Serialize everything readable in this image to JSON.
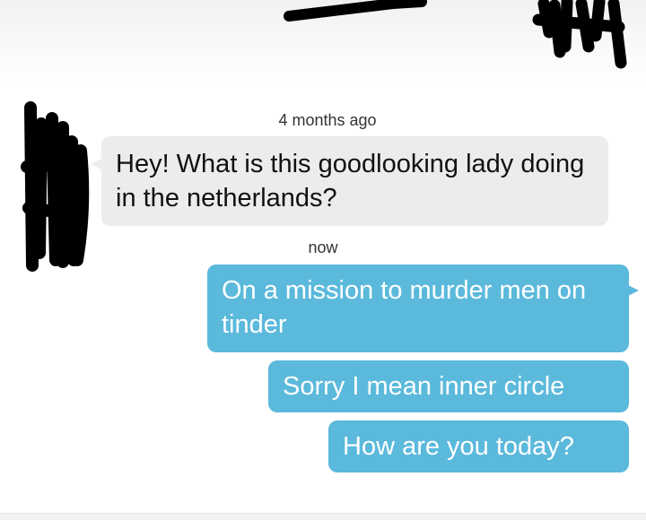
{
  "conversation": {
    "messages": [
      {
        "timestamp": "4 months ago",
        "direction": "incoming",
        "text": "Hey! What is this goodlooking lady doing in the netherlands?"
      },
      {
        "timestamp": "now",
        "direction": "outgoing",
        "text": "On a mission to murder men on tinder"
      },
      {
        "direction": "outgoing",
        "text": "Sorry I mean inner circle"
      },
      {
        "direction": "outgoing",
        "text": "How are you today?"
      }
    ]
  },
  "colors": {
    "incoming_bubble": "#ececec",
    "outgoing_bubble": "#5bb9dc",
    "redaction": "#000000"
  }
}
